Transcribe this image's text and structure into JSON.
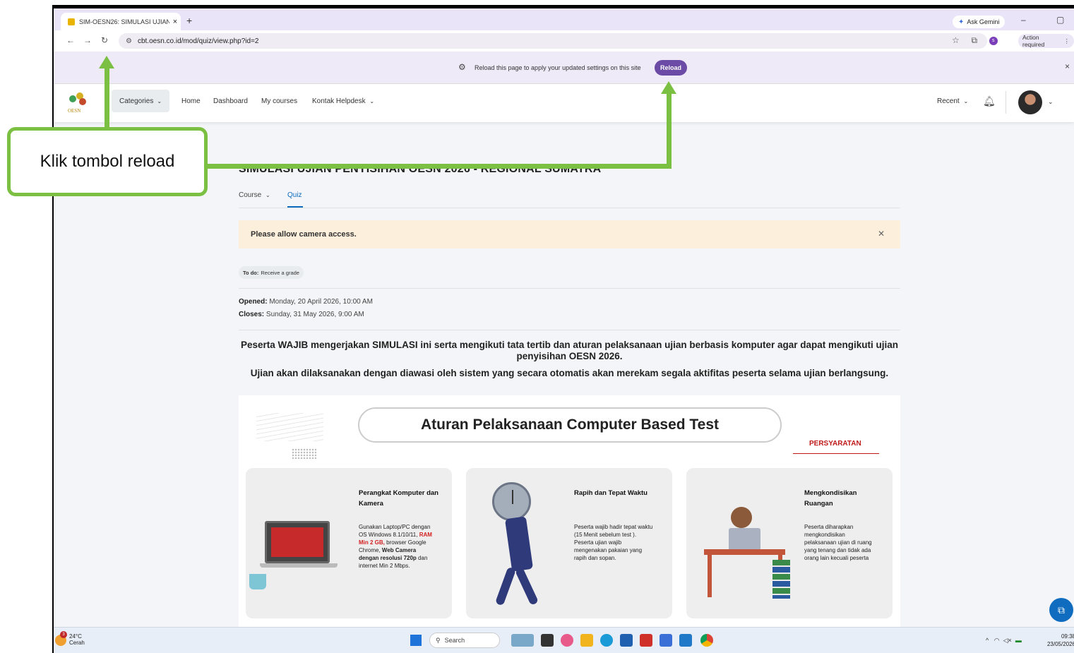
{
  "browser": {
    "tab_title": "SIM-OESN26: SIMULASI UJIAN",
    "tab_close": "×",
    "new_tab": "+",
    "gemini_label": "Ask Gemini",
    "window_controls": "–  ▢  ✕",
    "url": "cbt.oesn.co.id/mod/quiz/view.php?id=2",
    "action_required": "Action required",
    "profile_initial": "s"
  },
  "infobar": {
    "message": "Reload this page to apply your updated settings on this site",
    "reload_label": "Reload",
    "close": "×"
  },
  "nav": {
    "logo_text": "OESN",
    "categories": "Categories",
    "home": "Home",
    "dashboard": "Dashboard",
    "my_courses": "My courses",
    "helpdesk": "Kontak Helpdesk",
    "recent": "Recent"
  },
  "page": {
    "title": "SIMULASI UJIAN PENYISIHAN OESN 2026 - REGIONAL SUMATRA",
    "tab_course": "Course",
    "tab_quiz": "Quiz",
    "alert": "Please allow camera access.",
    "todo_label": "To do:",
    "todo_value": "Receive a grade",
    "opened_label": "Opened:",
    "opened_value": "Monday, 20 April 2026, 10:00 AM",
    "closes_label": "Closes:",
    "closes_value": "Sunday, 31 May 2026, 9:00 AM",
    "para1": "Peserta WAJIB mengerjakan SIMULASI ini serta mengikuti tata tertib dan aturan pelaksanaan ujian berbasis komputer agar dapat mengikuti ujian penyisihan OESN 2026.",
    "para2": "Ujian akan dilaksanakan dengan diawasi oleh sistem yang secara otomatis akan merekam segala aktifitas peserta selama ujian berlangsung."
  },
  "poster": {
    "heading": "Aturan Pelaksanaan Computer Based Test",
    "section": "PERSYARATAN",
    "cards": [
      {
        "title": "Perangkat Komputer dan Kamera",
        "body_a": "Gunakan Laptop/PC dengan OS Windows 8.1/10/11,",
        "body_red": "RAM Min 2 GB,",
        "body_b": "browser Google Chrome,",
        "body_bold": "Web Camera dengan resolusi 720p",
        "body_c": "dan internet Min 2 Mbps."
      },
      {
        "title": "Rapih dan Tepat Waktu",
        "body": "Peserta wajib hadir tepat waktu (15 Menit sebelum test ). Peserta ujian wajib mengenakan pakaian yang rapih dan sopan."
      },
      {
        "title": "Mengkondisikan Ruangan",
        "body": "Peserta diharapkan mengkondisikan pelaksanaan ujian di ruang yang tenang dan tidak ada orang lain kecuali peserta"
      }
    ]
  },
  "taskbar": {
    "weather_temp": "24°C",
    "weather_desc": "Cerah",
    "weather_badge": "3",
    "search": "Search",
    "time": "09:38",
    "date": "23/05/2026"
  },
  "annotation": {
    "callout": "Klik tombol reload"
  },
  "colors": {
    "accent_green": "#7bc043",
    "reload_purple": "#6b4ba5",
    "moodle_blue": "#0f6cbf",
    "alert_bg": "#fcefdc"
  }
}
